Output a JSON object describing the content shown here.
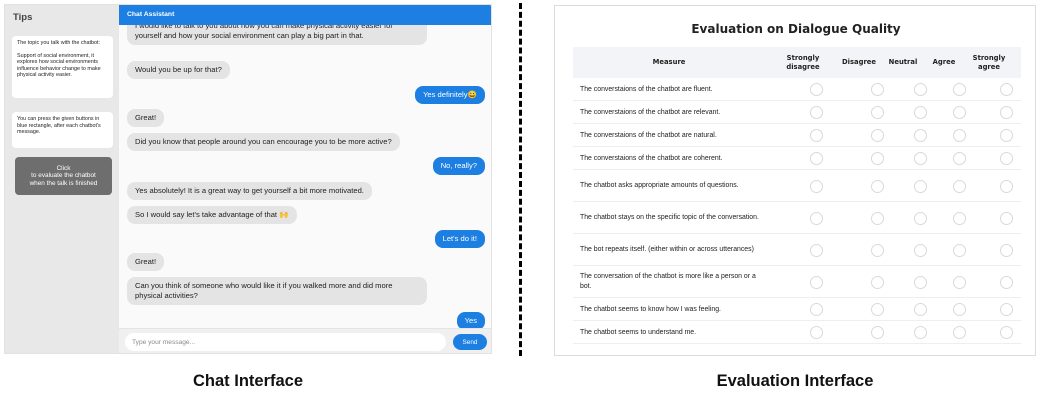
{
  "chat": {
    "tips_title": "Tips",
    "tips": [
      {
        "paragraphs": [
          "The topic you talk with the chatbot:",
          "Support of social environment, it explores how social environments influence behavior change to make physical activity easier."
        ]
      },
      {
        "paragraphs": [
          "You can press the given buttons in blue rectangle, after each chatbot's message."
        ]
      }
    ],
    "evaluate_button_label": "Click\nto evaluate the chatbot\nwhen the talk is finished",
    "header_title": "Chat Assistant",
    "messages": [
      {
        "role": "bot",
        "text": "I would like to talk to you about how you can make physical activity easier for yourself and how your social environment can play a big part in that."
      },
      {
        "role": "bot",
        "text": "Would you be up for that?"
      },
      {
        "role": "user",
        "text": "Yes definitely😀"
      },
      {
        "role": "bot",
        "text": "Great!"
      },
      {
        "role": "bot",
        "text": "Did you know that people around you can encourage you to be more active?"
      },
      {
        "role": "user",
        "text": "No, really?"
      },
      {
        "role": "bot",
        "text": "Yes absolutely! It is a great way to get yourself a bit more motivated."
      },
      {
        "role": "bot",
        "text": "So I would say let's take advantage of that 🙌"
      },
      {
        "role": "user",
        "text": "Let's do it!"
      },
      {
        "role": "bot",
        "text": "Great!"
      },
      {
        "role": "bot",
        "text": "Can you think of someone who would like it if you walked more and did more physical activities?"
      },
      {
        "role": "user",
        "text": "Yes"
      }
    ],
    "input_placeholder": "Type your message...",
    "send_label": "Send"
  },
  "evaluation": {
    "title": "Evaluation on Dialogue Quality",
    "columns": [
      "Measure",
      "Strongly disagree",
      "Disagree",
      "Neutral",
      "Agree",
      "Strongly agree"
    ],
    "measures": [
      "The converstaions of the chatbot are fluent.",
      "The converstaions of the chatbot are relevant.",
      "The converstaions of the chatbot are natural.",
      "The converstaions of the chatbot are coherent.",
      "The chatbot asks appropriate amounts of questions.",
      "The chatbot stays on the specific topic of the conversation.",
      "The bot repeats itself. (either within or across utterances)",
      "The conversation of the chatbot is more like a person or a bot.",
      "The chatbot seems to know how I was feeling.",
      "The chatbot seems to understand me."
    ]
  },
  "captions": {
    "chat": "Chat Interface",
    "evaluation": "Evaluation Interface"
  },
  "colors": {
    "accent": "#1d7fe2",
    "bot_bubble": "#e4e4e4",
    "evaluate_button": "#6e6e6e"
  }
}
